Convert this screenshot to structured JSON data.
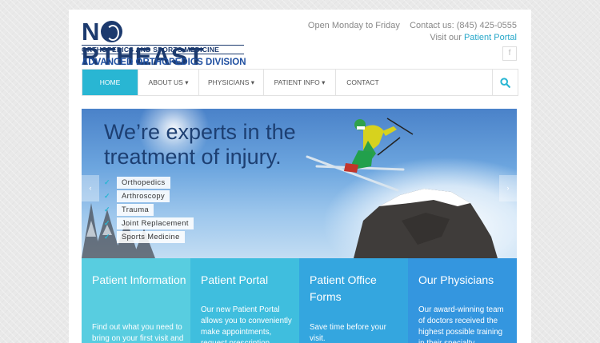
{
  "logo": {
    "pre": "N",
    "post": "RTHEAST",
    "sub1": "ORTHOPEDICS AND SPORTS MEDICINE",
    "sub2": "ADVANCED ORTHOPEDICS DIVISION"
  },
  "topbar": {
    "hours": "Open Monday to Friday",
    "contact": "Contact us: (845) 425-0555",
    "visit_prefix": "Visit our",
    "portal_link": "Patient Portal",
    "facebook_icon": "f"
  },
  "nav": {
    "items": [
      {
        "label": "HOME",
        "active": true
      },
      {
        "label": "ABOUT US ▾"
      },
      {
        "label": "PHYSICIANS ▾"
      },
      {
        "label": "PATIENT INFO ▾"
      },
      {
        "label": "CONTACT"
      }
    ],
    "search_icon": "search-icon"
  },
  "hero": {
    "title_line1": "We’re experts in the",
    "title_line2": "treatment of injury.",
    "bullets": [
      "Orthopedics",
      "Arthroscopy",
      "Trauma",
      "Joint Replacement",
      "Sports Medicine"
    ],
    "prev_arrow": "‹",
    "next_arrow": "›"
  },
  "features": [
    {
      "title": "Patient Information",
      "desc": "Find out what you need to bring on your first visit and",
      "color": "#58cde0"
    },
    {
      "title": "Patient Portal",
      "desc": "Our new Patient Portal allows you to conveniently make appointments, request prescription",
      "color": "#3fbede"
    },
    {
      "title": "Patient Office Forms",
      "desc": "Save time before your visit.",
      "color": "#34a6df"
    },
    {
      "title": "Our Physicians",
      "desc": "Our award-winning team of doctors received the highest possible training in their specialty",
      "color": "#3496df"
    }
  ]
}
